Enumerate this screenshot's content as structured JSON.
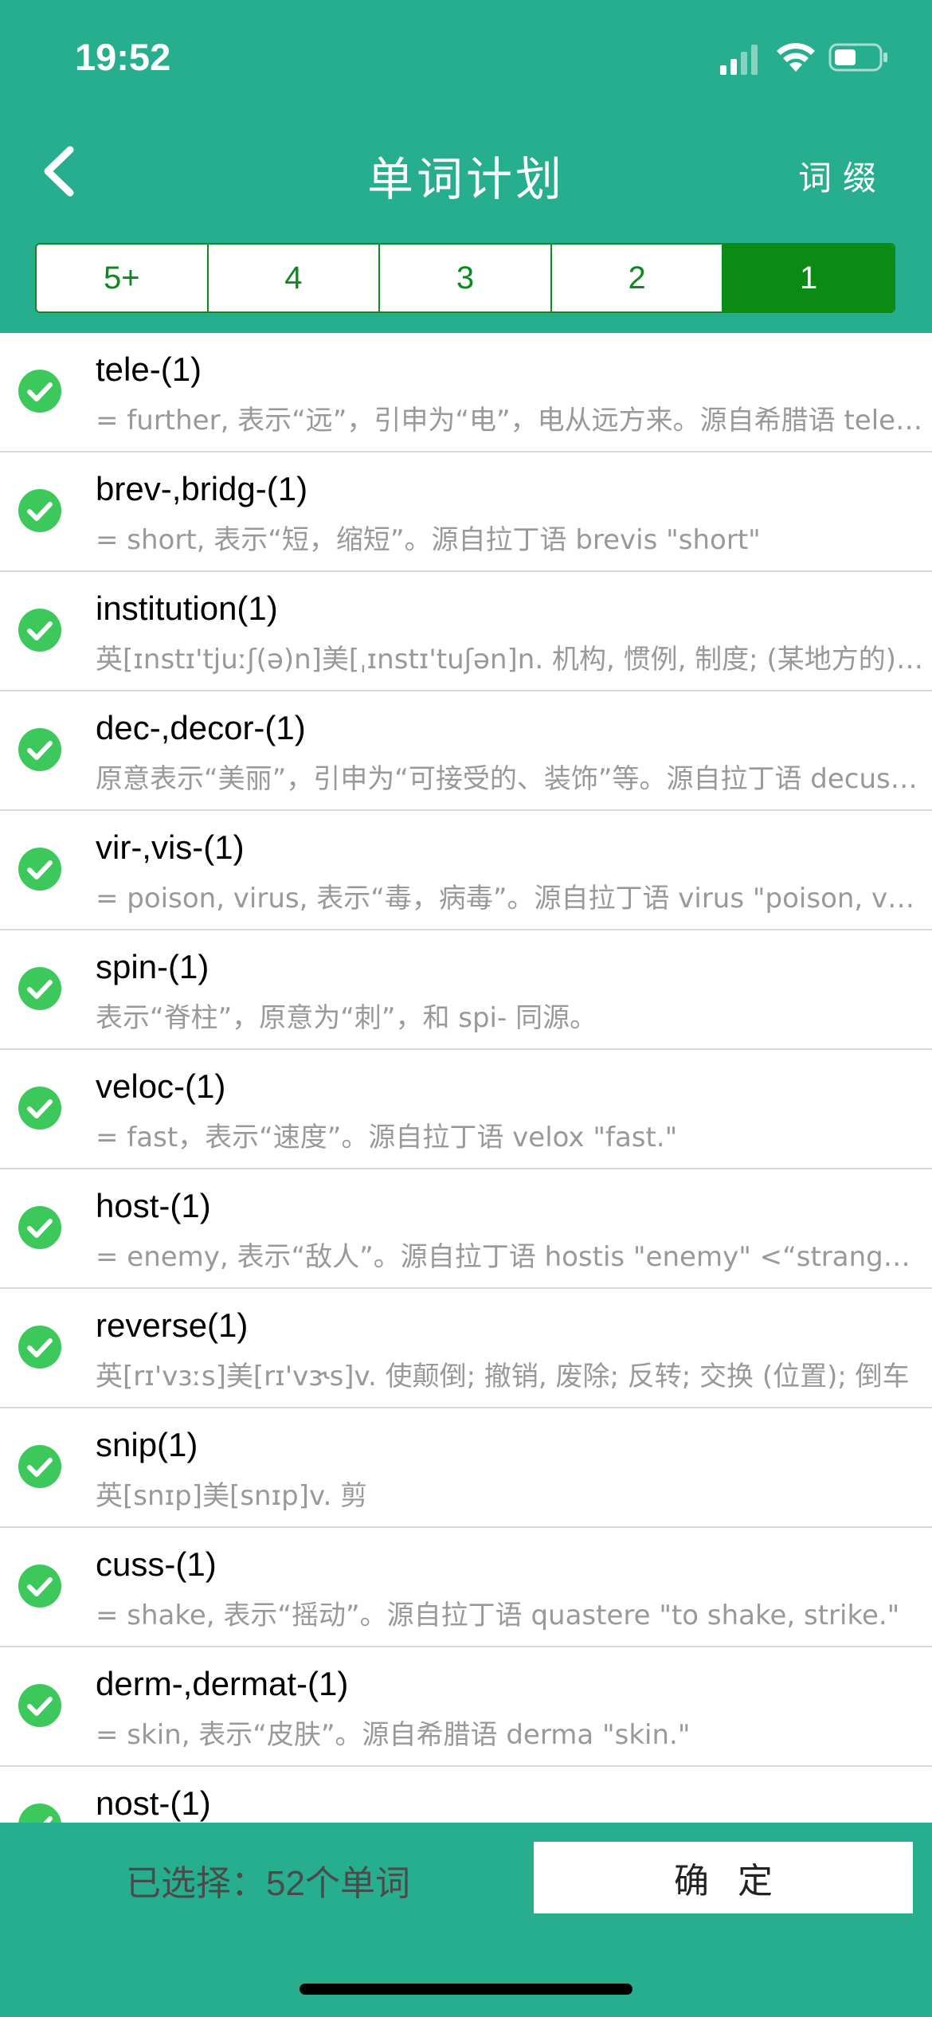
{
  "status_bar": {
    "time": "19:52"
  },
  "nav": {
    "title": "单词计划",
    "right_label": "词缀"
  },
  "segments": [
    {
      "label": "5+",
      "active": false
    },
    {
      "label": "4",
      "active": false
    },
    {
      "label": "3",
      "active": false
    },
    {
      "label": "2",
      "active": false
    },
    {
      "label": "1",
      "active": true
    }
  ],
  "words": [
    {
      "word": "tele-(1)",
      "desc": "= further, 表示“远”，引申为“电”，电从远方来。源自希腊语 tele \"far off\""
    },
    {
      "word": "brev-,bridg-(1)",
      "desc": "= short, 表示“短，缩短”。源自拉丁语 brevis \"short\""
    },
    {
      "word": "institution(1)",
      "desc": "英[ɪnstɪ'tjuːʃ(ə)n]美[ˌɪnstɪ'tuʃən]n. 机构, 惯例, 制度; (某地方的)知名人物"
    },
    {
      "word": "dec-,decor-(1)",
      "desc": "原意表示“美丽”，引申为“可接受的、装饰”等。源自拉丁语 decus \"ornament\""
    },
    {
      "word": "vir-,vis-(1)",
      "desc": "= poison, virus, 表示“毒，病毒”。源自拉丁语 virus \"poison, venom\""
    },
    {
      "word": "spin-(1)",
      "desc": "表示“脊柱”，原意为“刺”，和 spi- 同源。"
    },
    {
      "word": "veloc-(1)",
      "desc": "= fast，表示“速度”。源自拉丁语 velox \"fast.\""
    },
    {
      "word": "host-(1)",
      "desc": "= enemy, 表示“敌人”。源自拉丁语 hostis \"enemy\" <“stranger”"
    },
    {
      "word": "reverse(1)",
      "desc": "英[rɪ'vɜːs]美[rɪ'vɝs]v. 使颠倒; 撤销, 废除; 反转; 交换 (位置); 倒车"
    },
    {
      "word": "snip(1)",
      "desc": "英[snɪp]美[snɪp]v. 剪"
    },
    {
      "word": "cuss-(1)",
      "desc": "= shake, 表示“摇动”。源自拉丁语 quastere \"to shake, strike.\""
    },
    {
      "word": "derm-,dermat-(1)",
      "desc": "= skin, 表示“皮肤”。源自希腊语 derma \"skin.\""
    },
    {
      "word": "nost-(1)",
      "desc": ""
    }
  ],
  "footer": {
    "selected_text": "已选择：52个单词",
    "confirm_label": "确定"
  },
  "colors": {
    "header_bg": "#27ae8e",
    "segment_active": "#0b8a14",
    "check": "#3cc85a"
  }
}
